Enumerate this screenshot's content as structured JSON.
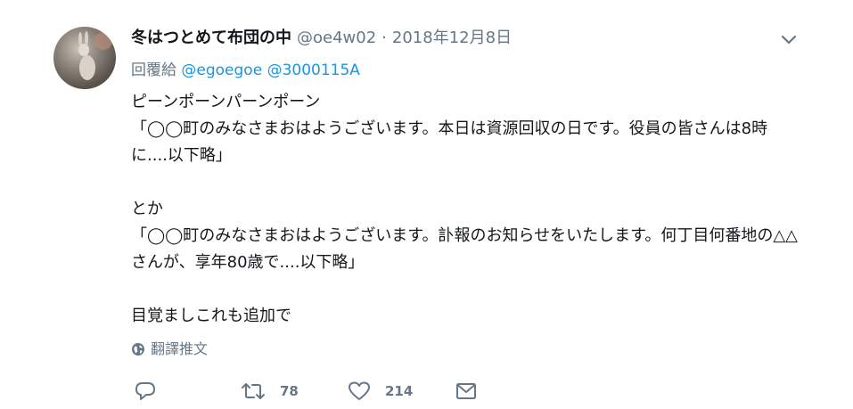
{
  "tweet": {
    "author_name": "冬はつとめて布団の中",
    "handle": "@oe4w02",
    "separator": "·",
    "date": "2018年12月8日",
    "reply_label": "回覆給",
    "reply_mentions": [
      "@egoegoe",
      "@3000115A"
    ],
    "body": "ピーンポーンパーンポーン\n「◯◯町のみなさまおはようございます。本日は資源回収の日です。役員の皆さんは8時に....以下略」\n\nとか\n「◯◯町のみなさまおはようございます。訃報のお知らせをいたします。何丁目何番地の△△さんが、享年80歳で....以下略」\n\n目覚ましこれも追加で",
    "translate_label": "翻譯推文",
    "retweet_count": "78",
    "like_count": "214"
  },
  "icons": {
    "menu": "chevron-down-icon",
    "globe": "globe-icon",
    "reply": "reply-icon",
    "retweet": "retweet-icon",
    "like": "heart-icon",
    "message": "envelope-icon"
  },
  "colors": {
    "link": "#1b95e0",
    "secondary_text": "#657786",
    "primary_text": "#14171a"
  }
}
